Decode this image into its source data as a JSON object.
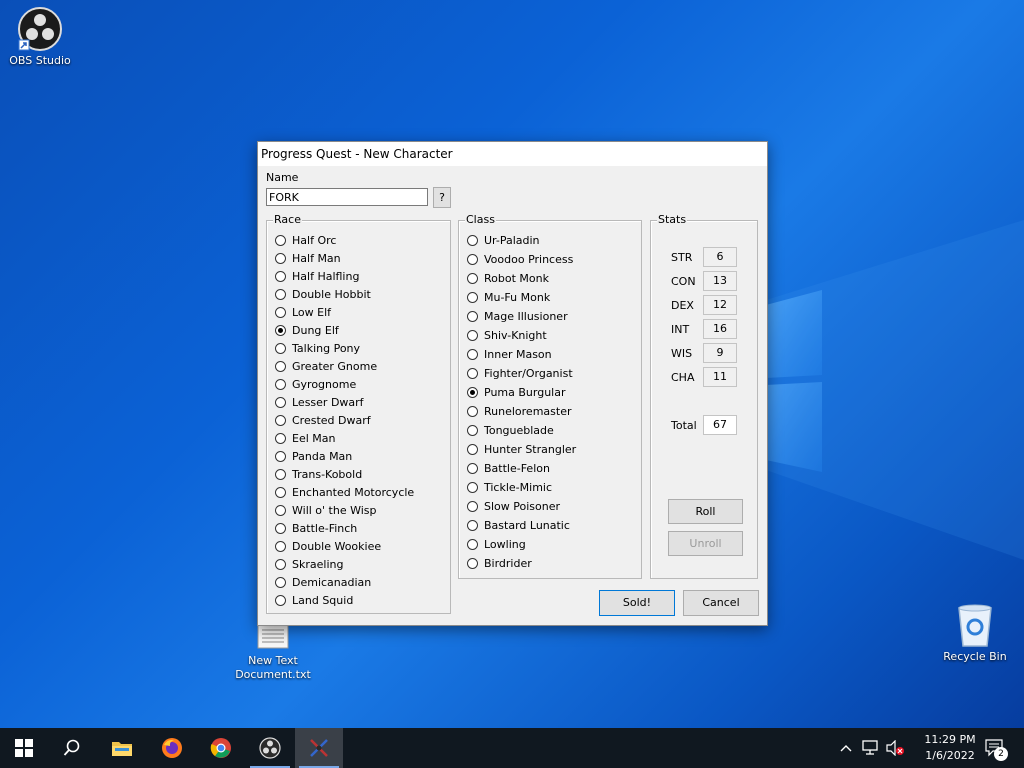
{
  "desktop": {
    "icons": {
      "obs": "OBS Studio",
      "textdoc_line1": "New Text",
      "textdoc_line2": "Document.txt",
      "recycle": "Recycle Bin"
    }
  },
  "window": {
    "title": "Progress Quest - New Character",
    "name_label": "Name",
    "name_value": "FORK",
    "name_help_button": "?",
    "race": {
      "legend": "Race",
      "selected": "Dung Elf",
      "options": [
        "Half Orc",
        "Half Man",
        "Half Halfling",
        "Double Hobbit",
        "Low Elf",
        "Dung Elf",
        "Talking Pony",
        "Greater Gnome",
        "Gyrognome",
        "Lesser Dwarf",
        "Crested Dwarf",
        "Eel Man",
        "Panda Man",
        "Trans-Kobold",
        "Enchanted Motorcycle",
        "Will o' the Wisp",
        "Battle-Finch",
        "Double Wookiee",
        "Skraeling",
        "Demicanadian",
        "Land Squid"
      ]
    },
    "class": {
      "legend": "Class",
      "selected": "Puma Burgular",
      "options": [
        "Ur-Paladin",
        "Voodoo Princess",
        "Robot Monk",
        "Mu-Fu Monk",
        "Mage Illusioner",
        "Shiv-Knight",
        "Inner Mason",
        "Fighter/Organist",
        "Puma Burgular",
        "Runeloremaster",
        "Tongueblade",
        "Hunter Strangler",
        "Battle-Felon",
        "Tickle-Mimic",
        "Slow Poisoner",
        "Bastard Lunatic",
        "Lowling",
        "Birdrider"
      ]
    },
    "stats": {
      "legend": "Stats",
      "items": [
        {
          "name": "STR",
          "value": "6"
        },
        {
          "name": "CON",
          "value": "13"
        },
        {
          "name": "DEX",
          "value": "12"
        },
        {
          "name": "INT",
          "value": "16"
        },
        {
          "name": "WIS",
          "value": "9"
        },
        {
          "name": "CHA",
          "value": "11"
        }
      ],
      "total_label": "Total",
      "total_value": "67",
      "roll_button": "Roll",
      "unroll_button": "Unroll"
    },
    "sold_button": "Sold!",
    "cancel_button": "Cancel"
  },
  "taskbar": {
    "items": [
      "start-icon",
      "search-icon",
      "file-explorer-icon",
      "firefox-icon",
      "chrome-icon",
      "obs-icon",
      "progress-quest-icon"
    ],
    "clock_time": "11:29 PM",
    "clock_date": "1/6/2022",
    "notification_count": "2"
  },
  "colors": {
    "accent": "#0078d7",
    "window_bg": "#f0f0f0",
    "taskbar_bg": "#101820"
  }
}
